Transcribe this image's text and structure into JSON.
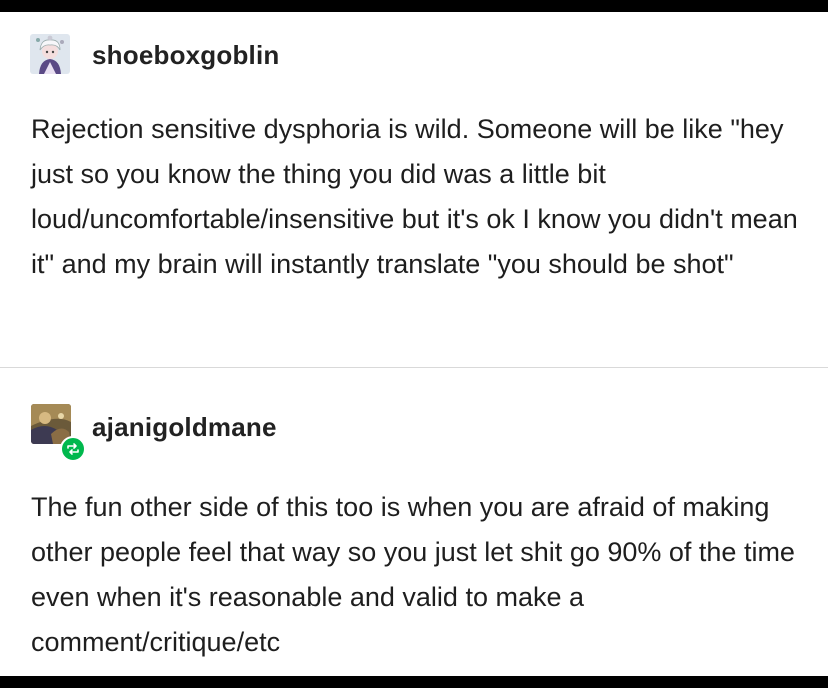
{
  "posts": [
    {
      "username": "shoeboxgoblin",
      "text": "Rejection sensitive dysphoria is wild. Someone will be like \"hey just so you know the thing you did was a little bit loud/uncomfortable/insensitive but it's ok I know you didn't mean it\" and my brain will instantly translate \"you should be shot\""
    },
    {
      "username": "ajanigoldmane",
      "text": "The fun other side of this too is when you are afraid of making other people feel that way so you just let shit go 90% of the time even when it's reasonable and valid to make a comment/critique/etc"
    }
  ],
  "icons": {
    "avatar_1": "cartoon-avatar-icon",
    "avatar_2": "fantasy-art-avatar-icon",
    "reblog": "reblog-icon"
  },
  "colors": {
    "reblog_badge": "#00b84d",
    "background": "#ffffff",
    "frame": "#000000"
  }
}
